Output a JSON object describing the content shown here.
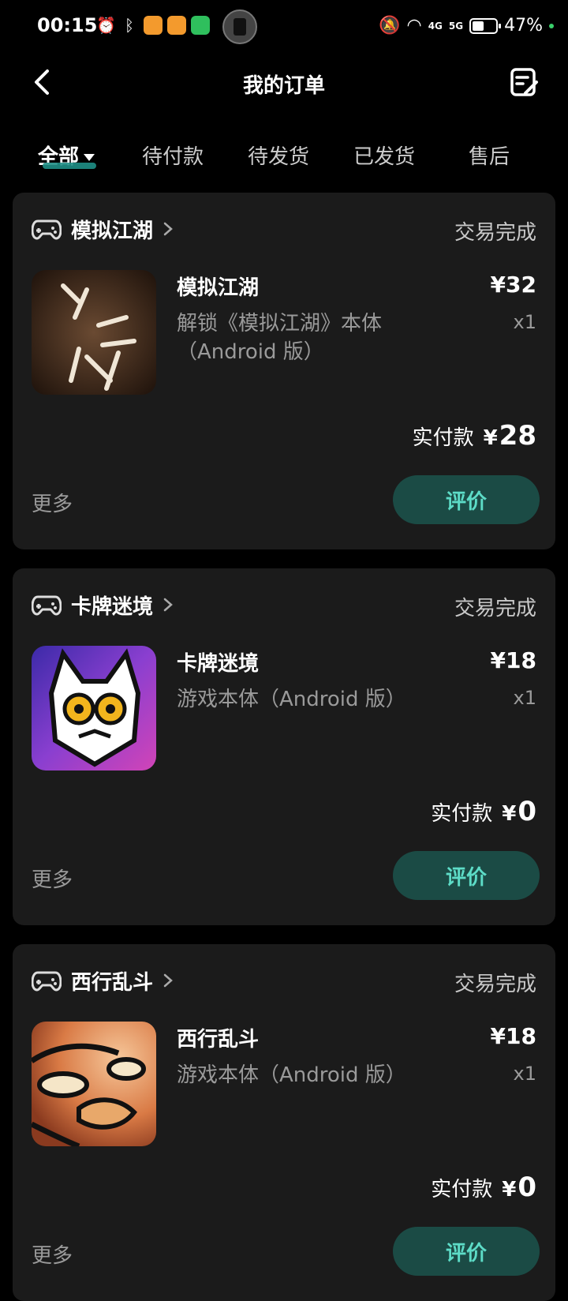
{
  "status_bar": {
    "time": "00:15",
    "battery": "47%",
    "network_4g": "4G",
    "network_5g": "5G"
  },
  "header": {
    "title": "我的订单"
  },
  "tabs": [
    {
      "label": "全部",
      "active": true
    },
    {
      "label": "待付款"
    },
    {
      "label": "待发货"
    },
    {
      "label": "已发货"
    },
    {
      "label": "售后"
    }
  ],
  "orders": [
    {
      "store": "模拟江湖",
      "status": "交易完成",
      "product_title": "模拟江湖",
      "product_desc": "解锁《模拟江湖》本体（Android 版）",
      "price": "¥32",
      "qty": "x1",
      "paid_label": "实付款",
      "paid_currency": "¥",
      "paid_amount": "28",
      "more": "更多",
      "review": "评价"
    },
    {
      "store": "卡牌迷境",
      "status": "交易完成",
      "product_title": "卡牌迷境",
      "product_desc": "游戏本体（Android 版）",
      "price": "¥18",
      "qty": "x1",
      "paid_label": "实付款",
      "paid_currency": "¥",
      "paid_amount": "0",
      "more": "更多",
      "review": "评价"
    },
    {
      "store": "西行乱斗",
      "status": "交易完成",
      "product_title": "西行乱斗",
      "product_desc": "游戏本体（Android 版）",
      "price": "¥18",
      "qty": "x1",
      "paid_label": "实付款",
      "paid_currency": "¥",
      "paid_amount": "0",
      "more": "更多",
      "review": "评价"
    }
  ],
  "icons": {
    "back": "chevron-left-icon",
    "edit": "note-edit-icon",
    "controller": "gamepad-icon",
    "chevron": "chevron-right-icon"
  },
  "colors": {
    "background": "#000000",
    "card": "#1b1b1b",
    "review_button_bg": "#1b4b45",
    "review_button_text": "#5ddcc7",
    "tab_indicator": "#1f8f86"
  }
}
